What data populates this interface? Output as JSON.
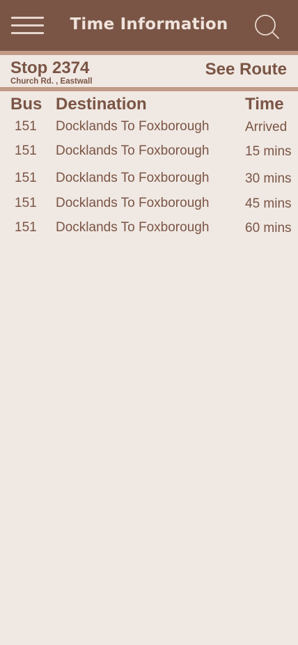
{
  "header": {
    "title": "Time Information",
    "menu_icon": "hamburger-menu-icon",
    "search_icon": "search-icon"
  },
  "stop": {
    "title": "Stop 2374",
    "address": "Church Rd. , Eastwall",
    "see_route_label": "See Route"
  },
  "table": {
    "columns": [
      "Bus",
      "Destination",
      "Time"
    ],
    "rows": [
      {
        "bus": "151",
        "destination": "Docklands To Foxborough",
        "time": "Arrived"
      },
      {
        "bus": "151",
        "destination": "Docklands To Foxborough",
        "time": "15 mins"
      },
      {
        "bus": "151",
        "destination": "Docklands To Foxborough",
        "time": "30 mins"
      },
      {
        "bus": "151",
        "destination": "Docklands To Foxborough",
        "time": "45 mins"
      },
      {
        "bus": "151",
        "destination": "Docklands To Foxborough",
        "time": "60 mins"
      }
    ]
  },
  "colors": {
    "header_bg": "#7a5545",
    "accent_bar": "#c29a88",
    "page_bg": "#f0e8e3",
    "text": "#7a5545"
  }
}
